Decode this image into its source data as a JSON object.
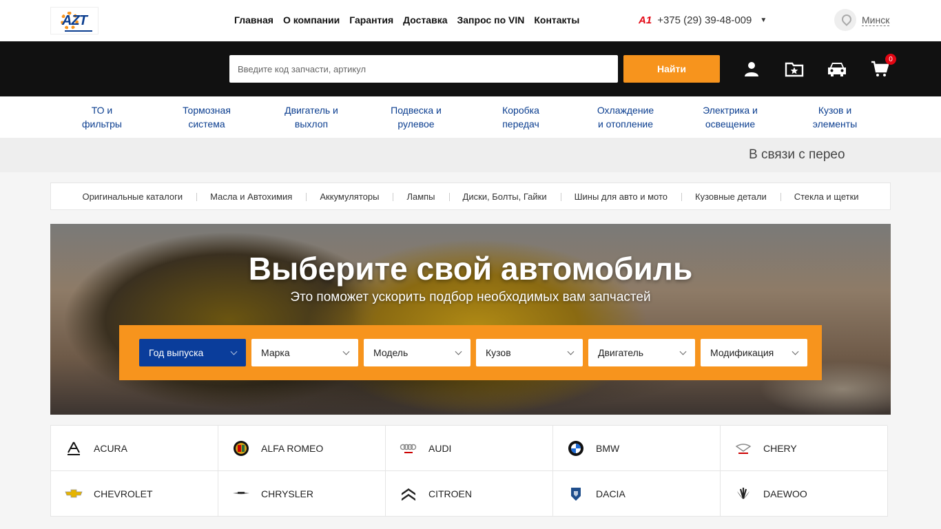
{
  "header": {
    "logo_text": "AZT",
    "nav": [
      "Главная",
      "О компании",
      "Гарантия",
      "Доставка",
      "Запрос по VIN",
      "Контакты"
    ],
    "operator_icon": "A1",
    "phone": "+375 (29) 39-48-009",
    "city": "Минск"
  },
  "search": {
    "placeholder": "Введите код запчасти, артикул",
    "button_label": "Найти",
    "cart_count": "0"
  },
  "categories": [
    [
      "ТО и",
      "фильтры"
    ],
    [
      "Тормозная",
      "система"
    ],
    [
      "Двигатель и",
      "выхлоп"
    ],
    [
      "Подвеска и",
      "рулевое"
    ],
    [
      "Коробка",
      "передач"
    ],
    [
      "Охлаждение",
      "и отопление"
    ],
    [
      "Электрика и",
      "освещение"
    ],
    [
      "Кузов и",
      "элементы"
    ]
  ],
  "ticker_text": "В связи с перео",
  "subnav": [
    "Оригинальные каталоги",
    "Масла и Автохимия",
    "Аккумуляторы",
    "Лампы",
    "Диски, Болты, Гайки",
    "Шины для авто и мото",
    "Кузовные детали",
    "Стекла и щетки"
  ],
  "hero": {
    "title": "Выберите свой автомобиль",
    "subtitle": "Это поможет ускорить подбор необходимых вам запчастей",
    "selectors": [
      "Год выпуска",
      "Марка",
      "Модель",
      "Кузов",
      "Двигатель",
      "Модификация"
    ]
  },
  "brands": [
    {
      "name": "ACURA",
      "icon": "acura-logo-icon"
    },
    {
      "name": "ALFA ROMEO",
      "icon": "alfa-romeo-logo-icon"
    },
    {
      "name": "AUDI",
      "icon": "audi-logo-icon"
    },
    {
      "name": "BMW",
      "icon": "bmw-logo-icon"
    },
    {
      "name": "CHERY",
      "icon": "chery-logo-icon"
    },
    {
      "name": "CHEVROLET",
      "icon": "chevrolet-logo-icon"
    },
    {
      "name": "CHRYSLER",
      "icon": "chrysler-logo-icon"
    },
    {
      "name": "CITROEN",
      "icon": "citroen-logo-icon"
    },
    {
      "name": "DACIA",
      "icon": "dacia-logo-icon"
    },
    {
      "name": "DAEWOO",
      "icon": "daewoo-logo-icon"
    }
  ],
  "colors": {
    "accent": "#f7941d",
    "brand_blue": "#0a3d9b",
    "dark": "#111111"
  }
}
